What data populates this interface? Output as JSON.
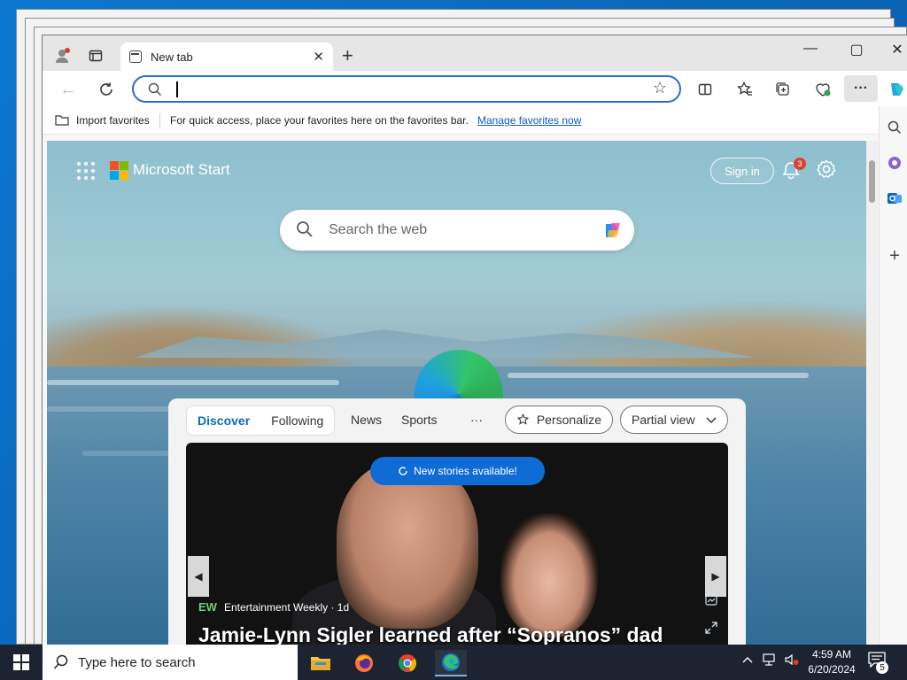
{
  "browser": {
    "tab_title": "New tab",
    "favorites_bar": {
      "import_label": "Import favorites",
      "hint": "For quick access, place your favorites here on the favorites bar.",
      "manage_link": "Manage favorites now"
    }
  },
  "start_page": {
    "brand": "Microsoft Start",
    "sign_in": "Sign in",
    "notifications_count": "3",
    "search_placeholder": "Search the web",
    "feed": {
      "tabs": [
        {
          "label": "Discover",
          "active": true
        },
        {
          "label": "Following",
          "active": false
        }
      ],
      "nav": [
        "News",
        "Sports",
        "···"
      ],
      "personalize": "Personalize",
      "view_mode": "Partial view",
      "new_stories": "New stories available!",
      "story": {
        "source_logo": "EW",
        "source": "Entertainment Weekly · 1d",
        "headline": "Jamie-Lynn Sigler learned after “Sopranos” dad"
      }
    }
  },
  "taskbar": {
    "search_placeholder": "Type here to search",
    "time": "4:59 AM",
    "date": "6/20/2024",
    "notification_count": "5"
  },
  "colors": {
    "accent": "#0f6cbd",
    "address_border": "#2b6fd6",
    "taskbar": "#1c2331",
    "badge": "#d5442e"
  }
}
